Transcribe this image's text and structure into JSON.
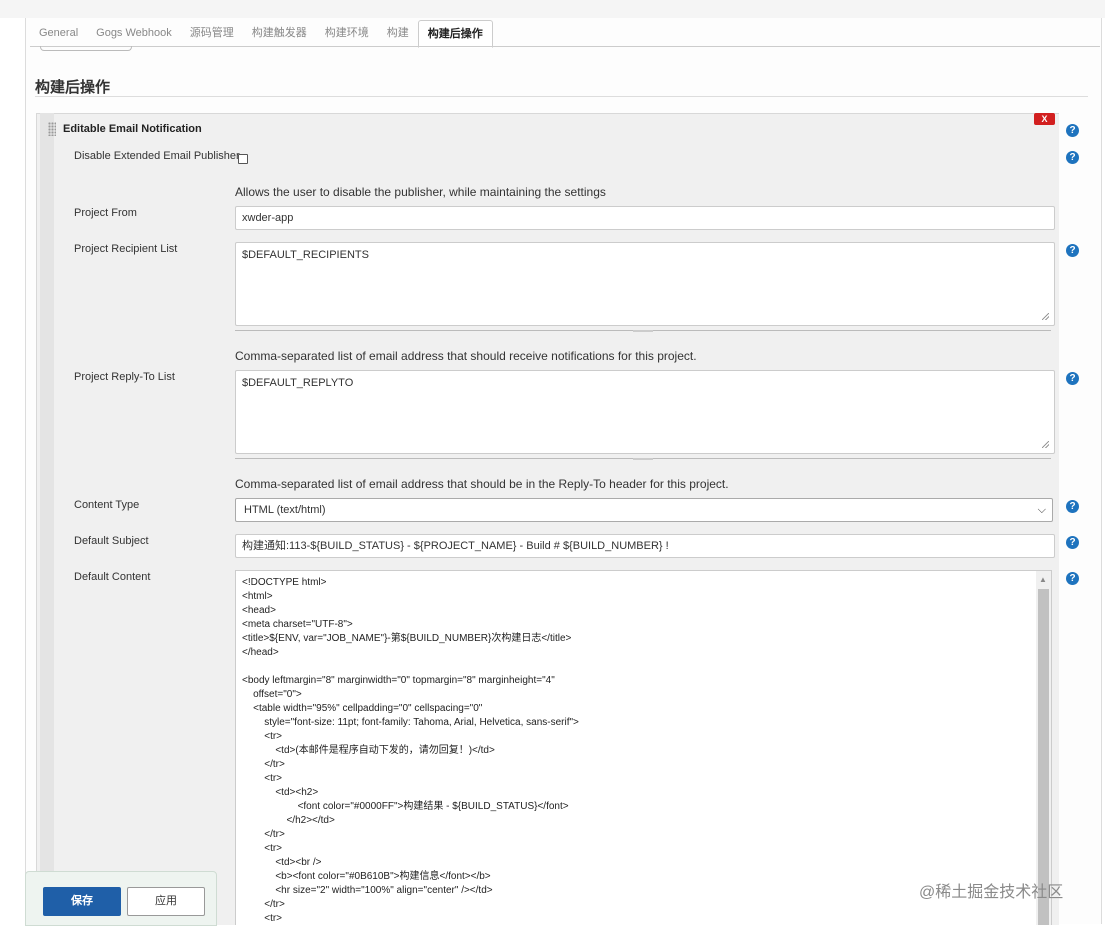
{
  "tabs": [
    "General",
    "Gogs Webhook",
    "源码管理",
    "构建触发器",
    "构建环境",
    "构建",
    "构建后操作"
  ],
  "active_tab_index": 6,
  "section_title": "构建后操作",
  "block": {
    "title": "Editable Email Notification",
    "delete_label": "X"
  },
  "help_glyph": "?",
  "fields": {
    "disable_publisher": {
      "label": "Disable Extended Email Publisher",
      "checked": false,
      "description": "Allows the user to disable the publisher, while maintaining the settings"
    },
    "project_from": {
      "label": "Project From",
      "value": "xwder-app"
    },
    "recipient_list": {
      "label": "Project Recipient List",
      "value": "$DEFAULT_RECIPIENTS",
      "description": "Comma-separated list of email address that should receive notifications for this project."
    },
    "reply_to_list": {
      "label": "Project Reply-To List",
      "value": "$DEFAULT_REPLYTO",
      "description": "Comma-separated list of email address that should be in the Reply-To header for this project."
    },
    "content_type": {
      "label": "Content Type",
      "value": "HTML (text/html)"
    },
    "default_subject": {
      "label": "Default Subject",
      "value": "构建通知:113-${BUILD_STATUS} - ${PROJECT_NAME} - Build # ${BUILD_NUMBER} !"
    },
    "default_content": {
      "label": "Default Content",
      "lines": [
        "<!DOCTYPE html>",
        "<html>",
        "<head>",
        "<meta charset=\"UTF-8\">",
        "<title>${ENV, var=\"JOB_NAME\"}-第${BUILD_NUMBER}次构建日志</title>",
        "</head>",
        "",
        "<body leftmargin=\"8\" marginwidth=\"0\" topmargin=\"8\" marginheight=\"4\"",
        "    offset=\"0\">",
        "    <table width=\"95%\" cellpadding=\"0\" cellspacing=\"0\"",
        "        style=\"font-size: 11pt; font-family: Tahoma, Arial, Helvetica, sans-serif\">",
        "        <tr>",
        "            <td>(本邮件是程序自动下发的，请勿回复！)</td>",
        "        </tr>",
        "        <tr>",
        "            <td><h2>",
        "                    <font color=\"#0000FF\">构建结果 - ${BUILD_STATUS}</font>",
        "                </h2></td>",
        "        </tr>",
        "        <tr>",
        "            <td><br />",
        "            <b><font color=\"#0B610B\">构建信息</font></b>",
        "            <hr size=\"2\" width=\"100%\" align=\"center\" /></td>",
        "        </tr>",
        "        <tr>"
      ]
    }
  },
  "buttons": {
    "save": "保存",
    "apply": "应用"
  },
  "watermark": "@稀土掘金技术社区",
  "colors": {
    "save_button": "#1f5fa8",
    "help_icon": "#1e73be",
    "delete_button": "#d21f1f"
  }
}
